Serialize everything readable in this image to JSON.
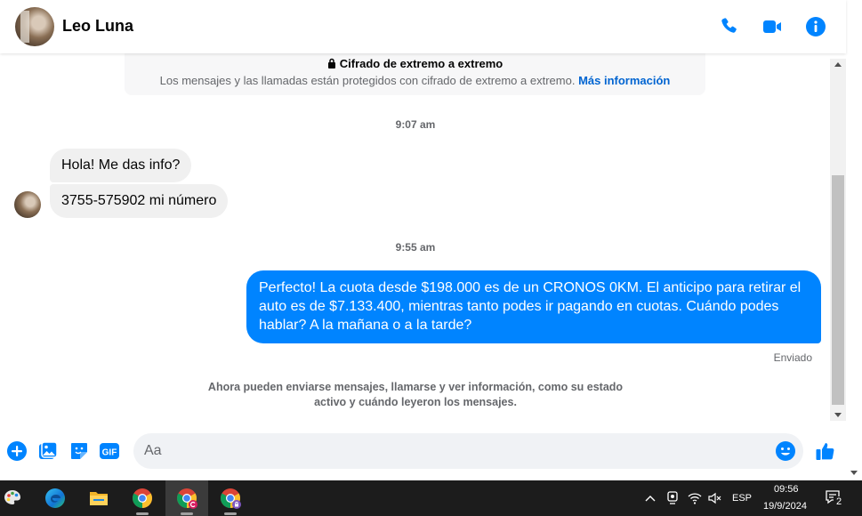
{
  "header": {
    "name": "Leo Luna",
    "icons": [
      "phone-icon",
      "video-call-icon",
      "info-icon"
    ]
  },
  "encryption": {
    "title": "Cifrado de extremo a extremo",
    "text": "Los mensajes y las llamadas están protegidos con cifrado de extremo a extremo.",
    "link": "Más información"
  },
  "timestamps": [
    "9:07 am",
    "9:55 am"
  ],
  "incoming": [
    "Hola! Me das info?",
    "3755-575902 mi número"
  ],
  "outgoing": "Perfecto! La cuota desde $198.000 es de un CRONOS 0KM. El anticipo para retirar el auto es de $7.133.400, mientras tanto podes ir pagando en cuotas. Cuándo podes hablar? A la mañana o a la tarde?",
  "status": "Enviado",
  "notice": "Ahora pueden enviarse mensajes, llamarse y ver información, como su estado activo y cuándo leyeron los mensajes.",
  "composer": {
    "placeholder": "Aa",
    "gif_label": "GIF",
    "icons": [
      "plus-icon",
      "photo-icon",
      "sticker-icon",
      "gif-icon",
      "emoji-icon",
      "like-icon"
    ]
  },
  "taskbar": {
    "apps": [
      "paint-icon",
      "edge-icon",
      "file-explorer-icon",
      "chrome-icon",
      "chrome-profile-icon",
      "chrome-profile-icon"
    ],
    "language": "ESP",
    "time": "09:56",
    "date": "19/9/2024",
    "notification_count": "2"
  },
  "colors": {
    "accent": "#0084ff",
    "incoming_bubble": "#f0f0f0",
    "secondary_text": "#65676b",
    "link": "#0064d1",
    "taskbar": "#1c1c1c"
  }
}
